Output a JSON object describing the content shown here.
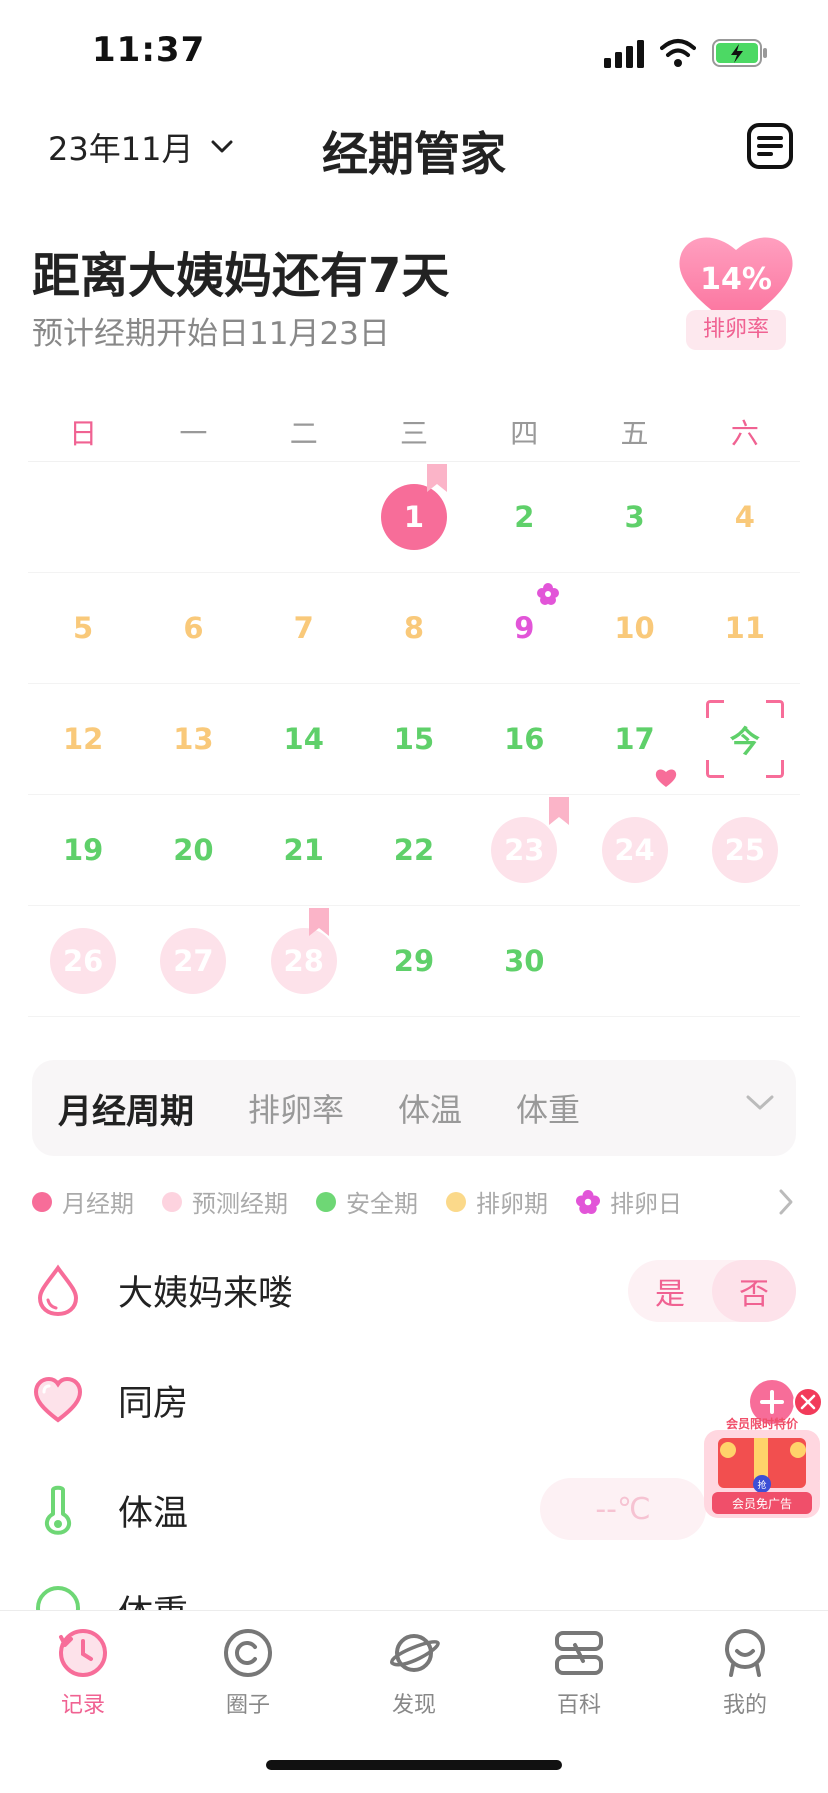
{
  "status_bar": {
    "time": "11:37"
  },
  "header": {
    "month": "23年11月",
    "title": "经期管家"
  },
  "summary": {
    "countdown": "距离大姨妈还有7天",
    "expected": "预计经期开始日11月23日",
    "ovulation_pct": "14%",
    "ovulation_label": "排卵率"
  },
  "weekdays": [
    "日",
    "一",
    "二",
    "三",
    "四",
    "五",
    "六"
  ],
  "calendar": {
    "rows": [
      [
        "",
        "",
        "",
        "1",
        "2",
        "3",
        "4"
      ],
      [
        "5",
        "6",
        "7",
        "8",
        "9",
        "10",
        "11"
      ],
      [
        "12",
        "13",
        "14",
        "15",
        "16",
        "17",
        "今"
      ],
      [
        "19",
        "20",
        "21",
        "22",
        "23",
        "24",
        "25"
      ],
      [
        "26",
        "27",
        "28",
        "29",
        "30",
        "",
        ""
      ]
    ]
  },
  "tabs": [
    "月经周期",
    "排卵率",
    "体温",
    "体重"
  ],
  "legend": [
    {
      "label": "月经期",
      "color": "#f76d99"
    },
    {
      "label": "预测经期",
      "color": "#fdd3df"
    },
    {
      "label": "安全期",
      "color": "#6ed775"
    },
    {
      "label": "排卵期",
      "color": "#fbd98a"
    },
    {
      "label": "排卵日",
      "color": "#e255d8"
    }
  ],
  "records": {
    "period": {
      "label": "大姨妈来喽",
      "yes": "是",
      "no": "否"
    },
    "intimacy": {
      "label": "同房"
    },
    "temperature": {
      "label": "体温",
      "placeholder": "--℃"
    },
    "weight": {
      "label": "体重"
    }
  },
  "promo": {
    "title": "会员限时特价",
    "sub": "会员免广告",
    "grab": "抢"
  },
  "nav": [
    "记录",
    "圈子",
    "发现",
    "百科",
    "我的"
  ],
  "colors": {
    "accent": "#f06292",
    "safe": "#5fd06a",
    "ovulation": "#f9c97a",
    "ovulation_day": "#e255d8"
  }
}
